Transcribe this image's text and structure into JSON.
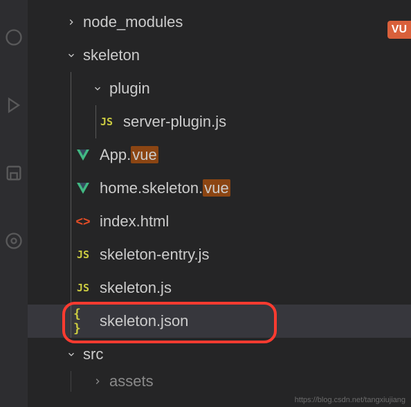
{
  "badge": "VU",
  "watermark": "https://blog.csdn.net/tangxiujiang",
  "tree": {
    "node_modules": "node_modules",
    "skeleton": "skeleton",
    "plugin": "plugin",
    "server_plugin": "server-plugin.js",
    "app_vue_prefix": "App.",
    "app_vue_ext": "vue",
    "home_prefix": "home.skeleton.",
    "home_ext": "vue",
    "index_html": "index.html",
    "skeleton_entry": "skeleton-entry.js",
    "skeleton_js": "skeleton.js",
    "skeleton_json": "skeleton.json",
    "src": "src",
    "assets": "assets"
  }
}
